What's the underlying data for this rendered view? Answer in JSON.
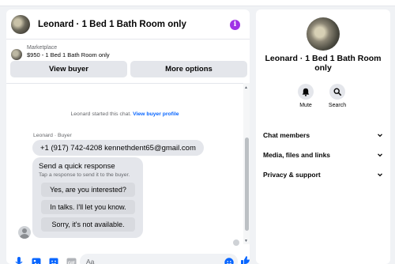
{
  "chat": {
    "title": "Leonard · 1 Bed 1 Bath Room only",
    "listing": {
      "label": "Marketplace",
      "subtitle": "$950 - 1 Bed 1 Bath Room only"
    },
    "buttons": {
      "view_buyer": "View buyer",
      "more_options": "More options"
    },
    "thread": {
      "started_text": "Leonard started this chat.",
      "started_link": "View buyer profile",
      "sender": "Leonard · Buyer",
      "message": "+1 (917) 742-4208 kennethdent65@gmail.com",
      "quick_title": "Send a quick response",
      "quick_sub": "Tap a response to send it to the buyer.",
      "replies": [
        "Yes, are you interested?",
        "In talks. I'll let you know.",
        "Sorry, it's not available."
      ]
    },
    "composer": {
      "placeholder": "Aa"
    }
  },
  "side": {
    "title": "Leonard · 1 Bed 1 Bath Room only",
    "actions": {
      "mute": "Mute",
      "search": "Search"
    },
    "sections": [
      "Chat members",
      "Media, files and links",
      "Privacy & support"
    ]
  },
  "colors": {
    "accent": "#0866ff",
    "info": "#a033e6",
    "button_bg": "#e4e6eb"
  },
  "icons": [
    "info-icon",
    "mic-icon",
    "photo-icon",
    "sticker-icon",
    "gif-icon",
    "emoji-icon",
    "thumbs-up-icon",
    "bell-icon",
    "search-icon",
    "chevron-down-icon"
  ]
}
